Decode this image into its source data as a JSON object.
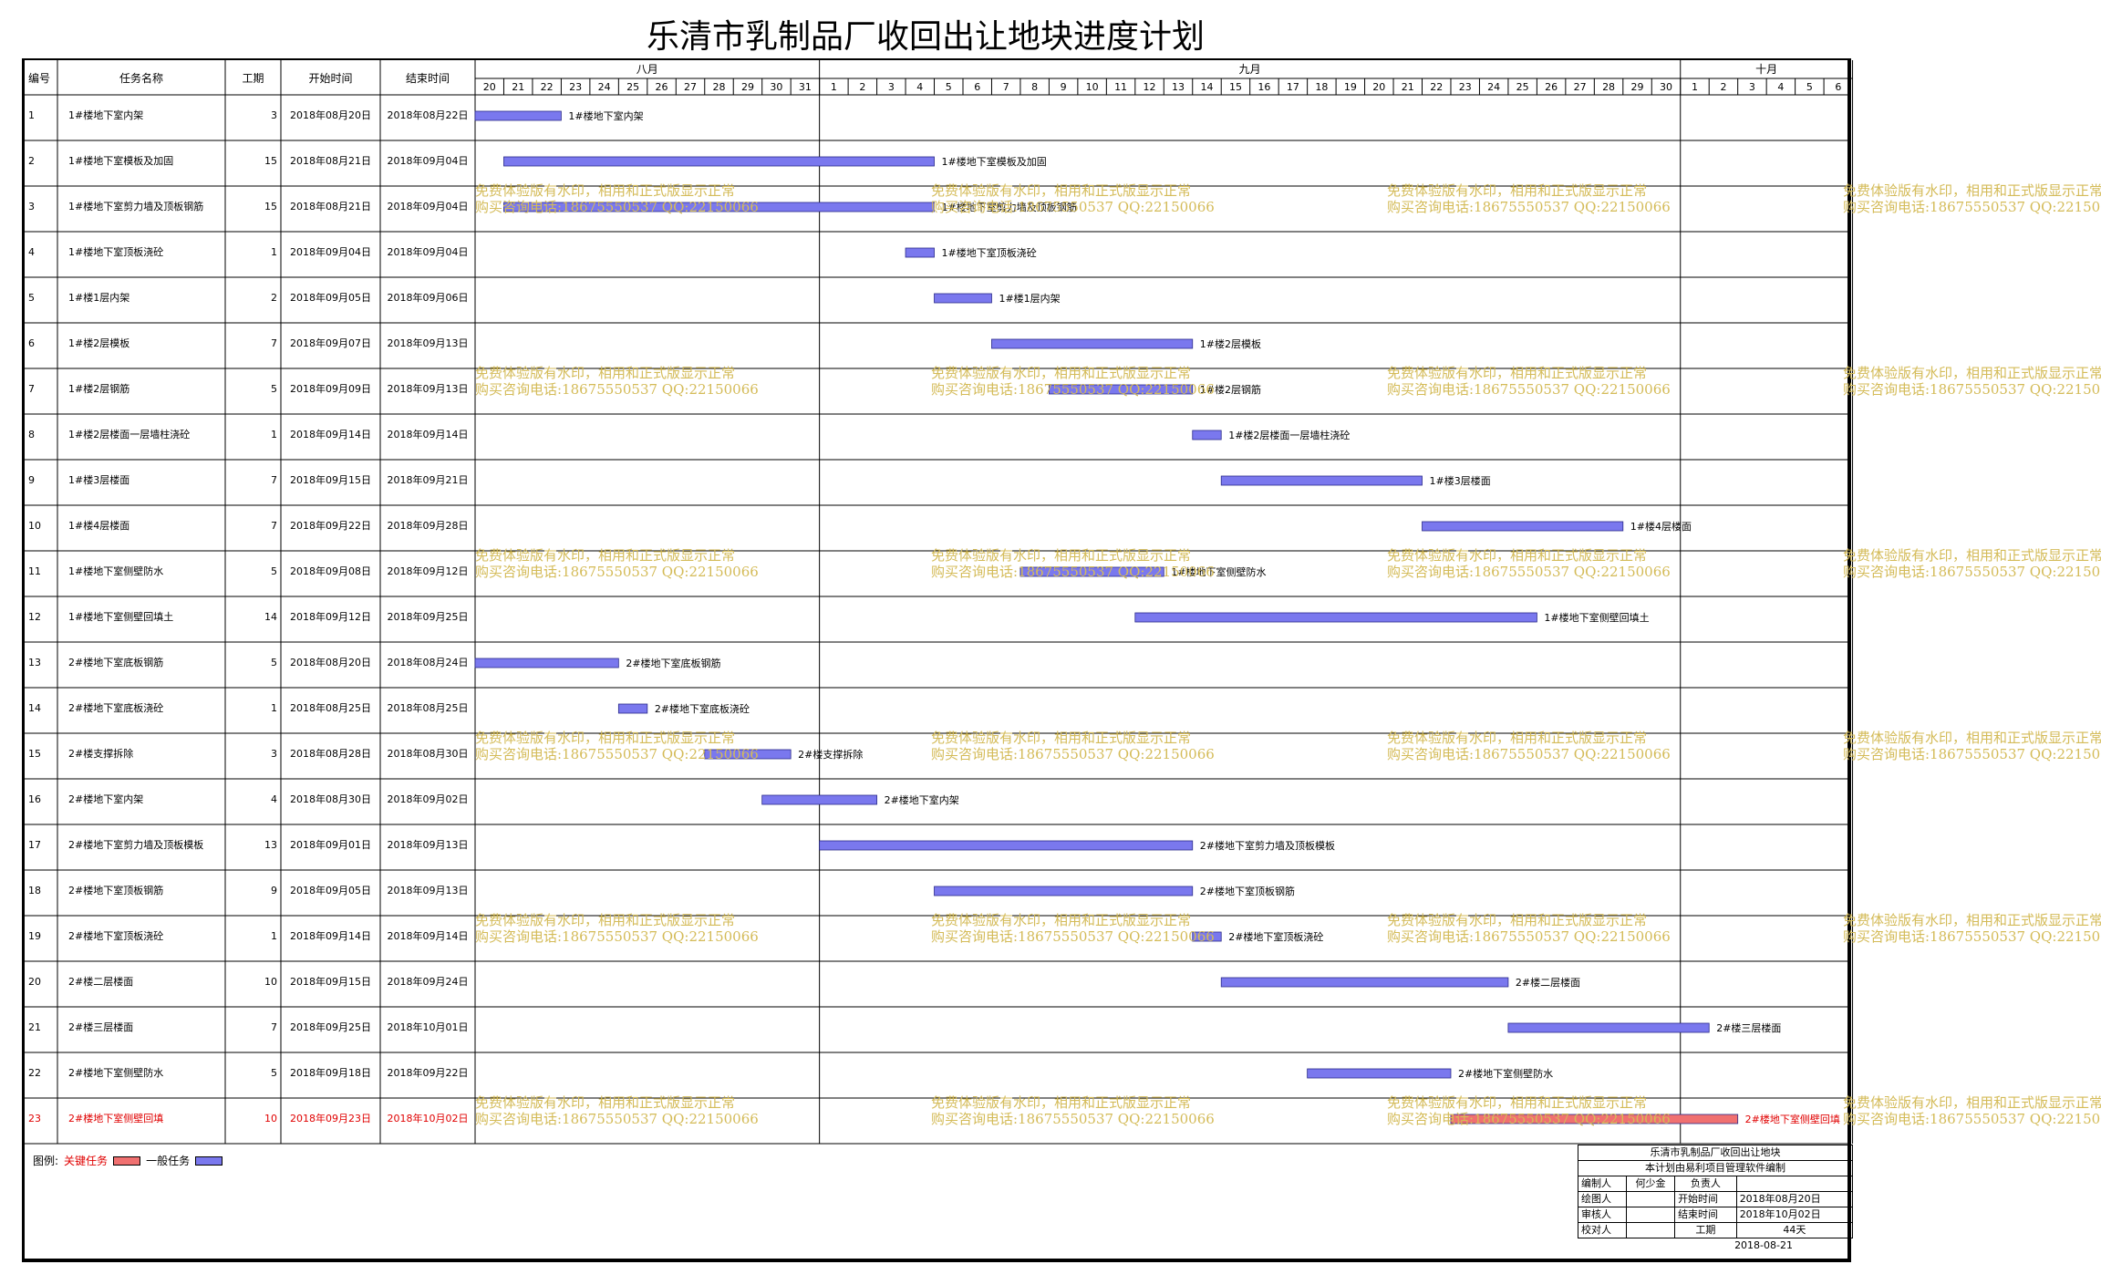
{
  "title": "乐清市乳制品厂收回出让地块进度计划",
  "headers": {
    "no": "编号",
    "name": "任务名称",
    "dur": "工期",
    "start": "开始时间",
    "end": "结束时间"
  },
  "months": [
    {
      "label": "八月",
      "days": [
        "20",
        "21",
        "22",
        "23",
        "24",
        "25",
        "26",
        "27",
        "28",
        "29",
        "30",
        "31"
      ]
    },
    {
      "label": "九月",
      "days": [
        "1",
        "2",
        "3",
        "4",
        "5",
        "6",
        "7",
        "8",
        "9",
        "10",
        "11",
        "12",
        "13",
        "14",
        "15",
        "16",
        "17",
        "18",
        "19",
        "20",
        "21",
        "22",
        "23",
        "24",
        "25",
        "26",
        "27",
        "28",
        "29",
        "30"
      ]
    },
    {
      "label": "十月",
      "days": [
        "1",
        "2",
        "3",
        "4",
        "5",
        "6"
      ]
    }
  ],
  "colors": {
    "normal": "#7a78ee",
    "critical": "#f07070",
    "critical_text": "#e00000",
    "grid": "#000000",
    "watermark": "#d4bb58"
  },
  "chart_data": {
    "type": "gantt",
    "timeline_start": "2018-08-20",
    "timeline_end": "2018-10-06",
    "tasks": [
      {
        "no": "1",
        "name": "1#楼地下室内架",
        "dur": "3",
        "start": "2018年08月20日",
        "end": "2018年08月22日",
        "s": "2018-08-20",
        "e": "2018-08-22",
        "critical": false
      },
      {
        "no": "2",
        "name": "1#楼地下室模板及加固",
        "dur": "15",
        "start": "2018年08月21日",
        "end": "2018年09月04日",
        "s": "2018-08-21",
        "e": "2018-09-04",
        "critical": false
      },
      {
        "no": "3",
        "name": "1#楼地下室剪力墙及顶板钢筋",
        "dur": "15",
        "start": "2018年08月21日",
        "end": "2018年09月04日",
        "s": "2018-08-21",
        "e": "2018-09-04",
        "critical": false
      },
      {
        "no": "4",
        "name": "1#楼地下室顶板浇砼",
        "dur": "1",
        "start": "2018年09月04日",
        "end": "2018年09月04日",
        "s": "2018-09-04",
        "e": "2018-09-04",
        "critical": false
      },
      {
        "no": "5",
        "name": "1#楼1层内架",
        "dur": "2",
        "start": "2018年09月05日",
        "end": "2018年09月06日",
        "s": "2018-09-05",
        "e": "2018-09-06",
        "critical": false
      },
      {
        "no": "6",
        "name": "1#楼2层模板",
        "dur": "7",
        "start": "2018年09月07日",
        "end": "2018年09月13日",
        "s": "2018-09-07",
        "e": "2018-09-13",
        "critical": false
      },
      {
        "no": "7",
        "name": "1#楼2层钢筋",
        "dur": "5",
        "start": "2018年09月09日",
        "end": "2018年09月13日",
        "s": "2018-09-09",
        "e": "2018-09-13",
        "critical": false
      },
      {
        "no": "8",
        "name": "1#楼2层楼面一层墙柱浇砼",
        "dur": "1",
        "start": "2018年09月14日",
        "end": "2018年09月14日",
        "s": "2018-09-14",
        "e": "2018-09-14",
        "critical": false
      },
      {
        "no": "9",
        "name": "1#楼3层楼面",
        "dur": "7",
        "start": "2018年09月15日",
        "end": "2018年09月21日",
        "s": "2018-09-15",
        "e": "2018-09-21",
        "critical": false
      },
      {
        "no": "10",
        "name": "1#楼4层楼面",
        "dur": "7",
        "start": "2018年09月22日",
        "end": "2018年09月28日",
        "s": "2018-09-22",
        "e": "2018-09-28",
        "critical": false
      },
      {
        "no": "11",
        "name": "1#楼地下室侧壁防水",
        "dur": "5",
        "start": "2018年09月08日",
        "end": "2018年09月12日",
        "s": "2018-09-08",
        "e": "2018-09-12",
        "critical": false
      },
      {
        "no": "12",
        "name": "1#楼地下室侧壁回填土",
        "dur": "14",
        "start": "2018年09月12日",
        "end": "2018年09月25日",
        "s": "2018-09-12",
        "e": "2018-09-25",
        "critical": false
      },
      {
        "no": "13",
        "name": "2#楼地下室底板钢筋",
        "dur": "5",
        "start": "2018年08月20日",
        "end": "2018年08月24日",
        "s": "2018-08-20",
        "e": "2018-08-24",
        "critical": false
      },
      {
        "no": "14",
        "name": "2#楼地下室底板浇砼",
        "dur": "1",
        "start": "2018年08月25日",
        "end": "2018年08月25日",
        "s": "2018-08-25",
        "e": "2018-08-25",
        "critical": false
      },
      {
        "no": "15",
        "name": "2#楼支撑拆除",
        "dur": "3",
        "start": "2018年08月28日",
        "end": "2018年08月30日",
        "s": "2018-08-28",
        "e": "2018-08-30",
        "critical": false
      },
      {
        "no": "16",
        "name": "2#楼地下室内架",
        "dur": "4",
        "start": "2018年08月30日",
        "end": "2018年09月02日",
        "s": "2018-08-30",
        "e": "2018-09-02",
        "critical": false
      },
      {
        "no": "17",
        "name": "2#楼地下室剪力墙及顶板模板",
        "dur": "13",
        "start": "2018年09月01日",
        "end": "2018年09月13日",
        "s": "2018-09-01",
        "e": "2018-09-13",
        "critical": false
      },
      {
        "no": "18",
        "name": "2#楼地下室顶板钢筋",
        "dur": "9",
        "start": "2018年09月05日",
        "end": "2018年09月13日",
        "s": "2018-09-05",
        "e": "2018-09-13",
        "critical": false
      },
      {
        "no": "19",
        "name": "2#楼地下室顶板浇砼",
        "dur": "1",
        "start": "2018年09月14日",
        "end": "2018年09月14日",
        "s": "2018-09-14",
        "e": "2018-09-14",
        "critical": false
      },
      {
        "no": "20",
        "name": "2#楼二层楼面",
        "dur": "10",
        "start": "2018年09月15日",
        "end": "2018年09月24日",
        "s": "2018-09-15",
        "e": "2018-09-24",
        "critical": false
      },
      {
        "no": "21",
        "name": "2#楼三层楼面",
        "dur": "7",
        "start": "2018年09月25日",
        "end": "2018年10月01日",
        "s": "2018-09-25",
        "e": "2018-10-01",
        "critical": false
      },
      {
        "no": "22",
        "name": "2#楼地下室侧壁防水",
        "dur": "5",
        "start": "2018年09月18日",
        "end": "2018年09月22日",
        "s": "2018-09-18",
        "e": "2018-09-22",
        "critical": false
      },
      {
        "no": "23",
        "name": "2#楼地下室侧壁回填",
        "dur": "10",
        "start": "2018年09月23日",
        "end": "2018年10月02日",
        "s": "2018-09-23",
        "e": "2018-10-02",
        "critical": true
      }
    ]
  },
  "legend": {
    "label": "图例:",
    "critical": "关键任务",
    "normal": "一般任务"
  },
  "info": {
    "project": "乐清市乳制品厂收回出让地块",
    "software": "本计划由易利项目管理软件编制",
    "editor_label": "编制人",
    "editor": "何少金",
    "owner_label": "负责人",
    "owner": "",
    "drawer_label": "绘图人",
    "drawer": "",
    "start_label": "开始时间",
    "start": "2018年08月20日",
    "reviewer_label": "审核人",
    "reviewer": "",
    "end_label": "结束时间",
    "end": "2018年10月02日",
    "checker_label": "校对人",
    "checker": "",
    "dur_label": "工期",
    "dur": "44天",
    "date": "2018-08-21"
  },
  "watermark": {
    "line1": "免费体验版有水印，相用和正式版显示正常",
    "line2": "购买咨询电话:18675550537 QQ:22150066"
  }
}
